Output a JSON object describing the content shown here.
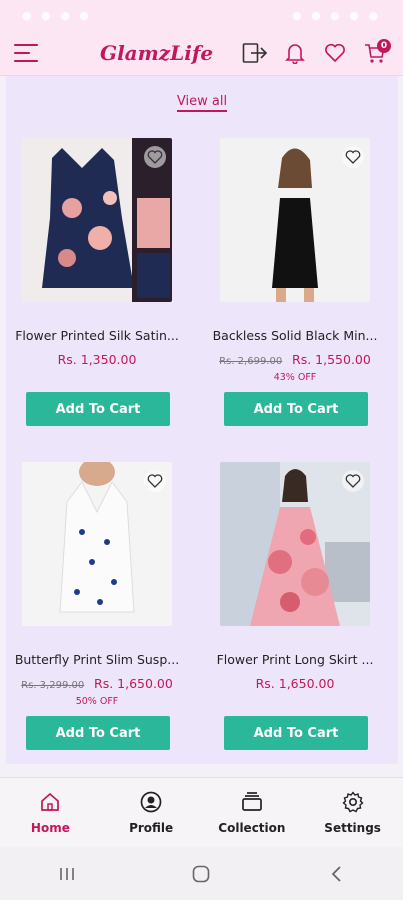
{
  "app": {
    "brand": "GlamzLife",
    "cart_count": "0"
  },
  "section": {
    "view_all": "View all"
  },
  "products": [
    {
      "name": "Flower Printed Silk Satin...",
      "old_price": "",
      "price": "Rs. 1,350.00",
      "discount": "",
      "button": "Add To Cart"
    },
    {
      "name": "Backless Solid Black Min...",
      "old_price": "Rs. 2,699.00",
      "price": "Rs. 1,550.00",
      "discount": "43% OFF",
      "button": "Add To Cart"
    },
    {
      "name": "Butterfly Print Slim Susp...",
      "old_price": "Rs. 3,299.00",
      "price": "Rs. 1,650.00",
      "discount": "50% OFF",
      "button": "Add To Cart"
    },
    {
      "name": "Flower Print Long Skirt ...",
      "old_price": "",
      "price": "Rs. 1,650.00",
      "discount": "",
      "button": "Add To Cart"
    }
  ],
  "bottom_nav": [
    {
      "label": "Home",
      "icon": "home-icon"
    },
    {
      "label": "Profile",
      "icon": "profile-icon"
    },
    {
      "label": "Collection",
      "icon": "collection-icon"
    },
    {
      "label": "Settings",
      "icon": "settings-icon"
    }
  ],
  "colors": {
    "accent": "#c2185b",
    "button": "#2bb79a",
    "header_bg": "#fde6f3",
    "content_bg": "#ede6fa"
  }
}
